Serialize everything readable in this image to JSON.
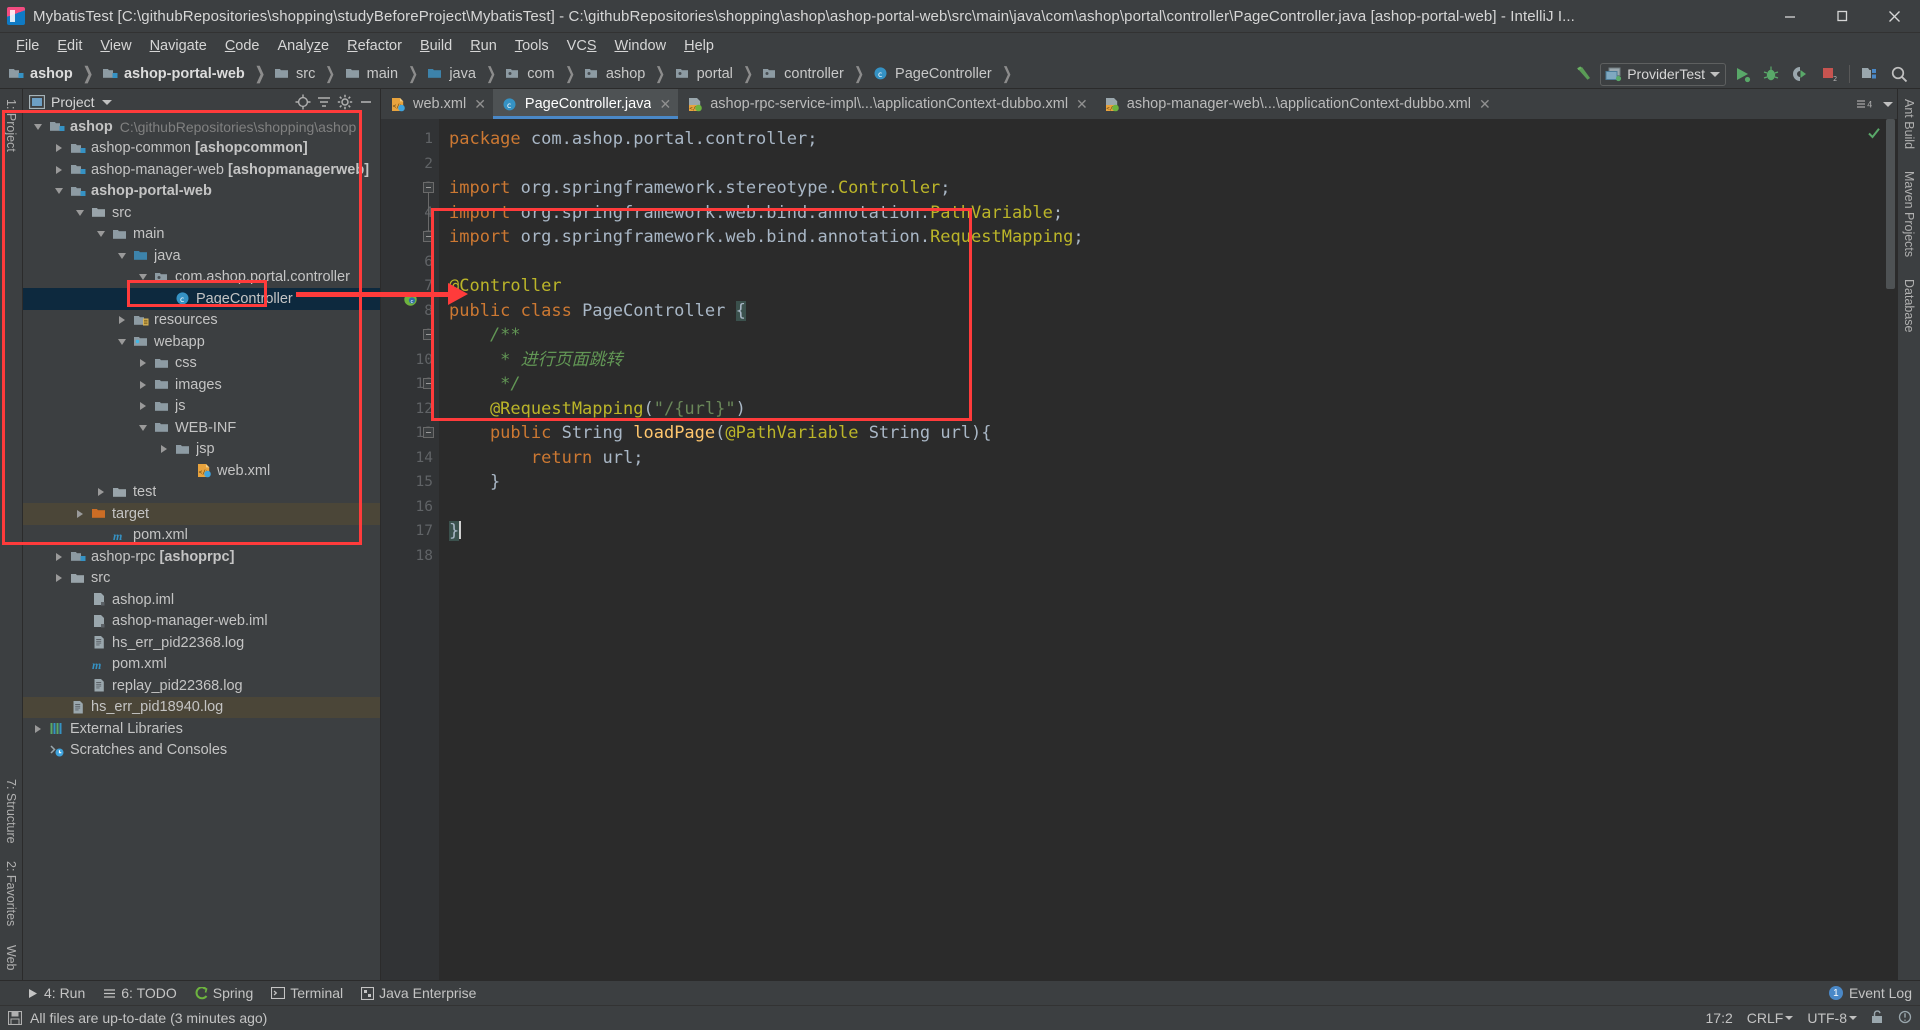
{
  "window": {
    "title": "MybatisTest [C:\\githubRepositories\\shopping\\studyBeforeProject\\MybatisTest] - C:\\githubRepositories\\shopping\\ashop\\ashop-portal-web\\src\\main\\java\\com\\ashop\\portal\\controller\\PageController.java [ashop-portal-web] - IntelliJ I...",
    "minimize": "–",
    "maximize": "❐",
    "close": "✕"
  },
  "menu": [
    {
      "label": "File",
      "accel": "F"
    },
    {
      "label": "Edit",
      "accel": "E"
    },
    {
      "label": "View",
      "accel": "V"
    },
    {
      "label": "Navigate",
      "accel": "N"
    },
    {
      "label": "Code",
      "accel": "C"
    },
    {
      "label": "Analyze",
      "accel": "z"
    },
    {
      "label": "Refactor",
      "accel": "R"
    },
    {
      "label": "Build",
      "accel": "B"
    },
    {
      "label": "Run",
      "accel": "R"
    },
    {
      "label": "Tools",
      "accel": "T"
    },
    {
      "label": "VCS",
      "accel": "S"
    },
    {
      "label": "Window",
      "accel": "W"
    },
    {
      "label": "Help",
      "accel": "H"
    }
  ],
  "breadcrumbs": [
    {
      "label": "ashop",
      "icon": "module-icon",
      "bold": true
    },
    {
      "label": "ashop-portal-web",
      "icon": "module-icon",
      "bold": true
    },
    {
      "label": "src",
      "icon": "folder-icon",
      "bold": false
    },
    {
      "label": "main",
      "icon": "folder-icon",
      "bold": false
    },
    {
      "label": "java",
      "icon": "source-folder-icon",
      "bold": false
    },
    {
      "label": "com",
      "icon": "package-icon",
      "bold": false
    },
    {
      "label": "ashop",
      "icon": "package-icon",
      "bold": false
    },
    {
      "label": "portal",
      "icon": "package-icon",
      "bold": false
    },
    {
      "label": "controller",
      "icon": "package-icon",
      "bold": false
    },
    {
      "label": "PageController",
      "icon": "class-icon",
      "bold": false
    }
  ],
  "toolbar": {
    "build_icon": "hammer-icon",
    "run_config": "ProviderTest",
    "run_config_icon": "application-icon",
    "dropdown_icon": "chevron-down-icon",
    "run_icon": "run-icon",
    "debug_icon": "debug-icon",
    "run_coverage_icon": "run-with-coverage-icon",
    "stop_icon": "stop-icon",
    "stop_badge": "2",
    "project_structure_icon": "project-structure-icon",
    "search_icon": "search-everywhere-icon"
  },
  "project_panel": {
    "title": "Project",
    "title_icon": "project-view-icon",
    "dropdown_icon": "chevron-down-icon",
    "locate_icon": "locate-target-icon",
    "collapse_icon": "collapse-all-icon",
    "settings_icon": "gear-icon",
    "hide_icon": "hide-panel-icon",
    "tree": [
      {
        "label": "ashop",
        "path": "C:\\githubRepositories\\shopping\\ashop",
        "indent": 0,
        "twisty": "down",
        "icon": "module-icon",
        "bold": true,
        "state": "none"
      },
      {
        "label": "ashop-common [ashopcommon]",
        "path": "",
        "indent": 1,
        "twisty": "right",
        "icon": "module-icon",
        "bold": false,
        "state": "none"
      },
      {
        "label": "ashop-manager-web [ashopmanagerweb]",
        "path": "",
        "indent": 1,
        "twisty": "right",
        "icon": "module-icon",
        "bold": false,
        "state": "none"
      },
      {
        "label": "ashop-portal-web",
        "path": "",
        "indent": 1,
        "twisty": "down",
        "icon": "module-icon",
        "bold": true,
        "state": "none"
      },
      {
        "label": "src",
        "path": "",
        "indent": 2,
        "twisty": "down",
        "icon": "folder-gray-icon",
        "bold": false,
        "state": "none"
      },
      {
        "label": "main",
        "path": "",
        "indent": 3,
        "twisty": "down",
        "icon": "folder-icon",
        "bold": false,
        "state": "none"
      },
      {
        "label": "java",
        "path": "",
        "indent": 4,
        "twisty": "down",
        "icon": "source-folder-icon",
        "bold": false,
        "state": "none"
      },
      {
        "label": "com.ashop.portal.controller",
        "path": "",
        "indent": 5,
        "twisty": "down",
        "icon": "package-icon",
        "bold": false,
        "state": "none"
      },
      {
        "label": "PageController",
        "path": "",
        "indent": 6,
        "twisty": "none",
        "icon": "class-icon",
        "bold": false,
        "state": "selected"
      },
      {
        "label": "resources",
        "path": "",
        "indent": 4,
        "twisty": "right",
        "icon": "resource-folder-icon",
        "bold": false,
        "state": "none"
      },
      {
        "label": "webapp",
        "path": "",
        "indent": 4,
        "twisty": "down",
        "icon": "webapp-folder-icon",
        "bold": false,
        "state": "none"
      },
      {
        "label": "css",
        "path": "",
        "indent": 5,
        "twisty": "right",
        "icon": "folder-icon",
        "bold": false,
        "state": "none"
      },
      {
        "label": "images",
        "path": "",
        "indent": 5,
        "twisty": "right",
        "icon": "folder-icon",
        "bold": false,
        "state": "none"
      },
      {
        "label": "js",
        "path": "",
        "indent": 5,
        "twisty": "right",
        "icon": "folder-icon",
        "bold": false,
        "state": "none"
      },
      {
        "label": "WEB-INF",
        "path": "",
        "indent": 5,
        "twisty": "down",
        "icon": "folder-icon",
        "bold": false,
        "state": "none"
      },
      {
        "label": "jsp",
        "path": "",
        "indent": 6,
        "twisty": "right",
        "icon": "folder-icon",
        "bold": false,
        "state": "none"
      },
      {
        "label": "web.xml",
        "path": "",
        "indent": 7,
        "twisty": "none",
        "icon": "xml-web-icon",
        "bold": false,
        "state": "none"
      },
      {
        "label": "test",
        "path": "",
        "indent": 3,
        "twisty": "right",
        "icon": "folder-gray-icon",
        "bold": false,
        "state": "none"
      },
      {
        "label": "target",
        "path": "",
        "indent": 2,
        "twisty": "right",
        "icon": "folder-orange-icon",
        "bold": false,
        "state": "highlight"
      },
      {
        "label": "pom.xml",
        "path": "",
        "indent": 3,
        "twisty": "none",
        "icon": "maven-icon",
        "bold": false,
        "state": "none"
      },
      {
        "label": "ashop-rpc [ashoprpc]",
        "path": "",
        "indent": 1,
        "twisty": "right",
        "icon": "module-icon",
        "bold": false,
        "state": "none"
      },
      {
        "label": "src",
        "path": "",
        "indent": 1,
        "twisty": "right",
        "icon": "folder-gray-icon",
        "bold": false,
        "state": "none"
      },
      {
        "label": "ashop.iml",
        "path": "",
        "indent": 2,
        "twisty": "none",
        "icon": "iml-icon",
        "bold": false,
        "state": "none"
      },
      {
        "label": "ashop-manager-web.iml",
        "path": "",
        "indent": 2,
        "twisty": "none",
        "icon": "iml-icon",
        "bold": false,
        "state": "none"
      },
      {
        "label": "hs_err_pid22368.log",
        "path": "",
        "indent": 2,
        "twisty": "none",
        "icon": "log-file-icon",
        "bold": false,
        "state": "none"
      },
      {
        "label": "pom.xml",
        "path": "",
        "indent": 2,
        "twisty": "none",
        "icon": "maven-icon",
        "bold": false,
        "state": "none"
      },
      {
        "label": "replay_pid22368.log",
        "path": "",
        "indent": 2,
        "twisty": "none",
        "icon": "log-file-icon",
        "bold": false,
        "state": "none"
      },
      {
        "label": "hs_err_pid18940.log",
        "path": "",
        "indent": 1,
        "twisty": "none",
        "icon": "log-file-icon",
        "bold": false,
        "state": "highlight"
      },
      {
        "label": "External Libraries",
        "path": "",
        "indent": 0,
        "twisty": "right",
        "icon": "libraries-icon",
        "bold": false,
        "state": "none"
      },
      {
        "label": "Scratches and Consoles",
        "path": "",
        "indent": 0,
        "twisty": "none",
        "icon": "scratches-icon",
        "bold": false,
        "state": "none"
      }
    ]
  },
  "editor_tabs": [
    {
      "label": "web.xml",
      "icon": "xml-web-icon",
      "active": false,
      "close": "✕"
    },
    {
      "label": "PageController.java",
      "icon": "class-icon",
      "active": true,
      "close": "✕"
    },
    {
      "label": "ashop-rpc-service-impl\\...\\applicationContext-dubbo.xml",
      "icon": "spring-xml-icon",
      "active": false,
      "close": "✕"
    },
    {
      "label": "ashop-manager-web\\...\\applicationContext-dubbo.xml",
      "icon": "spring-xml-icon",
      "active": false,
      "close": "✕"
    }
  ],
  "editor": {
    "tabs_overflow_icon": "chevron-down-icon",
    "line_numbers": [
      "1",
      "2",
      "3",
      "4",
      "5",
      "6",
      "7",
      "8",
      "9",
      "10",
      "11",
      "12",
      "13",
      "14",
      "15",
      "16",
      "17",
      "18"
    ],
    "code_lines": [
      {
        "n": 1,
        "tokens": [
          {
            "t": "package ",
            "c": "k"
          },
          {
            "t": "com.ashop.portal.controller;",
            "c": "t"
          }
        ]
      },
      {
        "n": 2,
        "tokens": []
      },
      {
        "n": 3,
        "tokens": [
          {
            "t": "import ",
            "c": "k"
          },
          {
            "t": "org.springframework.stereotype.",
            "c": "t"
          },
          {
            "t": "Controller",
            "c": "an"
          },
          {
            "t": ";",
            "c": "t"
          }
        ]
      },
      {
        "n": 4,
        "tokens": [
          {
            "t": "import ",
            "c": "k"
          },
          {
            "t": "org.springframework.web.bind.annotation.",
            "c": "t"
          },
          {
            "t": "PathVariable",
            "c": "an"
          },
          {
            "t": ";",
            "c": "t"
          }
        ]
      },
      {
        "n": 5,
        "tokens": [
          {
            "t": "import ",
            "c": "k"
          },
          {
            "t": "org.springframework.web.bind.annotation.",
            "c": "t"
          },
          {
            "t": "RequestMapping",
            "c": "an"
          },
          {
            "t": ";",
            "c": "t"
          }
        ]
      },
      {
        "n": 6,
        "tokens": []
      },
      {
        "n": 7,
        "tokens": [
          {
            "t": "@Controller",
            "c": "an"
          }
        ]
      },
      {
        "n": 8,
        "tokens": [
          {
            "t": "public class ",
            "c": "k"
          },
          {
            "t": "PageController ",
            "c": "t"
          },
          {
            "t": "{",
            "c": "brhl"
          }
        ]
      },
      {
        "n": 9,
        "tokens": [
          {
            "t": "    /**",
            "c": "cm"
          }
        ]
      },
      {
        "n": 10,
        "tokens": [
          {
            "t": "     * 进行页面跳转",
            "c": "cm"
          }
        ]
      },
      {
        "n": 11,
        "tokens": [
          {
            "t": "     */",
            "c": "cm"
          }
        ]
      },
      {
        "n": 12,
        "tokens": [
          {
            "t": "    @RequestMapping",
            "c": "an"
          },
          {
            "t": "(",
            "c": "t"
          },
          {
            "t": "\"/{url}\"",
            "c": "s"
          },
          {
            "t": ")",
            "c": "t"
          }
        ]
      },
      {
        "n": 13,
        "tokens": [
          {
            "t": "    public ",
            "c": "k"
          },
          {
            "t": "String ",
            "c": "t"
          },
          {
            "t": "loadPage",
            "c": "m"
          },
          {
            "t": "(",
            "c": "t"
          },
          {
            "t": "@PathVariable ",
            "c": "an"
          },
          {
            "t": "String url",
            "c": "t"
          },
          {
            "t": "){",
            "c": "t"
          }
        ]
      },
      {
        "n": 14,
        "tokens": [
          {
            "t": "        return ",
            "c": "k"
          },
          {
            "t": "url;",
            "c": "t"
          }
        ]
      },
      {
        "n": 15,
        "tokens": [
          {
            "t": "    }",
            "c": "t"
          }
        ]
      },
      {
        "n": 16,
        "tokens": []
      },
      {
        "n": 17,
        "tokens": [
          {
            "t": "}",
            "c": "brhl"
          }
        ]
      },
      {
        "n": 18,
        "tokens": []
      }
    ],
    "inspection_status": "ok-checkmark-icon"
  },
  "annotations": {
    "project_box": "red-highlight-box-project-tree",
    "class_box": "red-highlight-box-pagecontroller",
    "code_box": "red-highlight-box-controller-code",
    "arrow": "red-arrow-pointing-to-code"
  },
  "left_rail": {
    "top": [
      {
        "label": "1: Project",
        "icon": "project-tool-icon"
      }
    ],
    "bottom": [
      {
        "label": "7: Structure",
        "icon": "structure-tool-icon"
      },
      {
        "label": "2: Favorites",
        "icon": "favorites-tool-icon"
      },
      {
        "label": "Web",
        "icon": "web-tool-icon"
      }
    ]
  },
  "right_rail": [
    {
      "label": "Ant Build",
      "icon": "ant-build-icon"
    },
    {
      "label": "Maven Projects",
      "icon": "maven-projects-icon"
    },
    {
      "label": "Database",
      "icon": "database-icon"
    }
  ],
  "bottom_bar": {
    "items": [
      {
        "label": "4: Run",
        "icon": "run-icon",
        "accel": "4"
      },
      {
        "label": "6: TODO",
        "icon": "todo-icon",
        "accel": "6"
      },
      {
        "label": "Spring",
        "icon": "spring-icon",
        "accel": ""
      },
      {
        "label": "Terminal",
        "icon": "terminal-icon",
        "accel": ""
      },
      {
        "label": "Java Enterprise",
        "icon": "java-enterprise-icon",
        "accel": ""
      }
    ],
    "event_log": "Event Log",
    "event_log_count": "1"
  },
  "status_bar": {
    "message": "All files are up-to-date (3 minutes ago)",
    "message_icon": "save-icon",
    "caret_position": "17:2",
    "line_separator": "CRLF",
    "encoding": "UTF-8",
    "lock_icon": "unlocked-icon",
    "git_branch_icon": "branch-icon",
    "inspection_icon": "inspections-icon"
  }
}
